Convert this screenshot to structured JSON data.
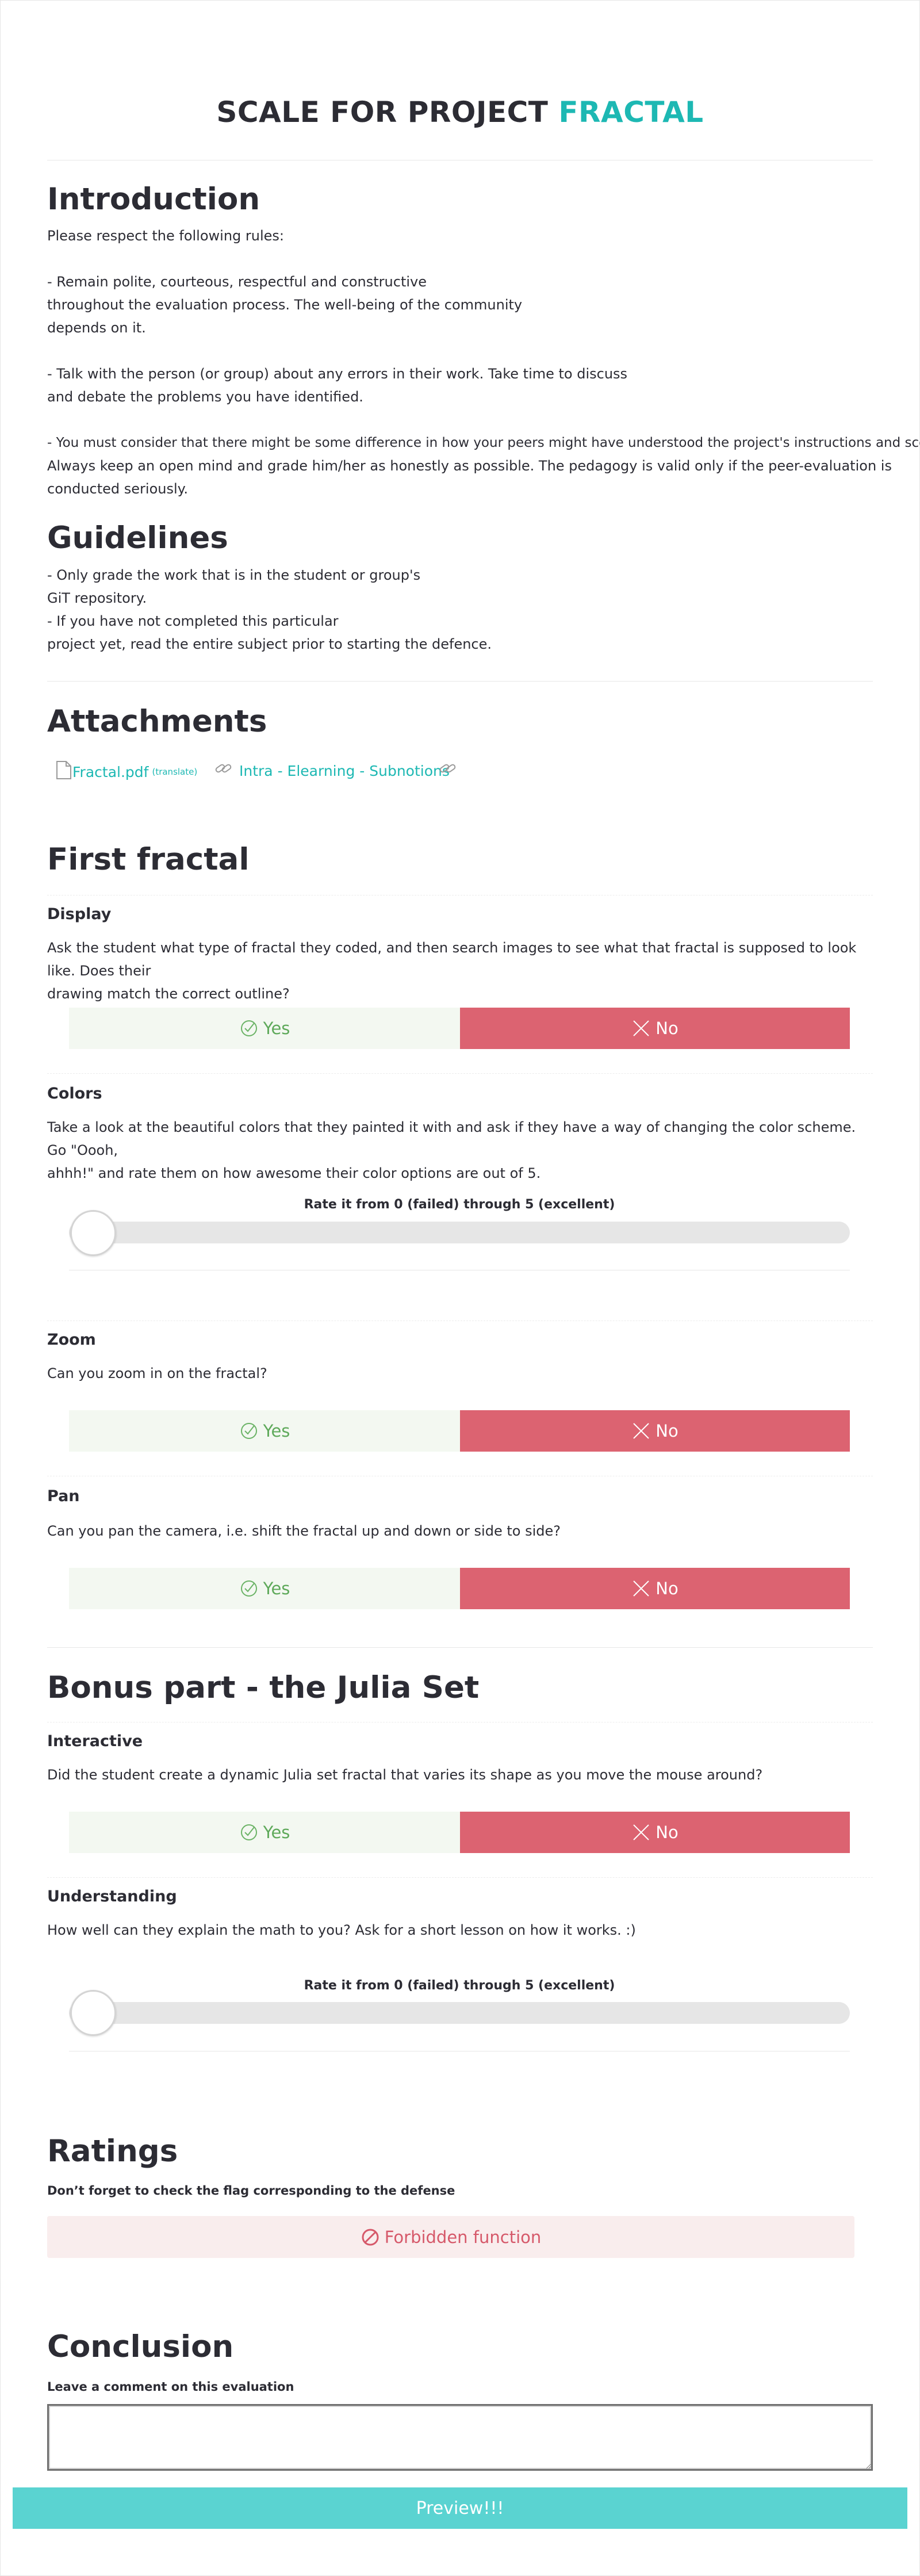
{
  "header": {
    "title_prefix": "SCALE FOR PROJECT",
    "title_accent": "FRACTAL"
  },
  "introduction": {
    "title": "Introduction",
    "lines": [
      "Please respect the following rules:",
      "",
      "- Remain polite, courteous, respectful and constructive",
      "throughout the evaluation process. The well-being of the community",
      "depends on it.",
      "",
      "- Talk with the person (or group) about any errors in their work. Take time to discuss",
      "and debate the problems you have identified.",
      "",
      "- You must consider that there might be some difference in how your peers might have understood the project's instructions and scope.",
      "Always keep an open mind and grade him/her as honestly as possible. The pedagogy is valid only if the peer-evaluation is",
      "conducted seriously."
    ]
  },
  "guidelines": {
    "title": "Guidelines",
    "lines": [
      "- Only grade the work that is in the student or group's",
      "GiT repository.",
      "- If you have not completed this particular",
      "project yet, read the entire subject prior to starting the defence."
    ]
  },
  "attachments": {
    "title": "Attachments",
    "items": [
      {
        "label": "Fractal.pdf",
        "sub": "(translate)",
        "icon": "file-icon"
      },
      {
        "label": "Intra - Elearning - Subnotions",
        "icon": "link-icon"
      },
      {
        "label": "",
        "icon": "link-icon"
      }
    ]
  },
  "sections": [
    {
      "title": "First fractal",
      "questions": [
        {
          "title": "Display",
          "desc": [
            "Ask the student what type of fractal they coded, and then search images to see what that fractal is supposed to look like. Does their",
            "drawing match the correct outline?"
          ],
          "type": "yesno",
          "yes": "Yes",
          "no": "No"
        },
        {
          "title": "Colors",
          "desc": [
            "Take a look at the beautiful colors that they painted it with and ask if they have a way of changing the color scheme. Go \"Oooh,",
            "ahhh!\" and rate them on how awesome their color options are out of 5."
          ],
          "type": "rate",
          "rate_label": "Rate it from 0 (failed) through 5 (excellent)",
          "value": 0
        },
        {
          "title": "Zoom",
          "desc": [
            "Can you zoom in on the fractal?"
          ],
          "type": "yesno",
          "yes": "Yes",
          "no": "No"
        },
        {
          "title": "Pan",
          "desc": [
            "Can you pan the camera, i.e. shift the fractal up and down or side to side?"
          ],
          "type": "yesno",
          "yes": "Yes",
          "no": "No"
        }
      ]
    },
    {
      "title": "Bonus part - the Julia Set",
      "questions": [
        {
          "title": "Interactive",
          "desc": [
            "Did the student create a dynamic Julia set fractal that varies its shape as you move the mouse around?"
          ],
          "type": "yesno",
          "yes": "Yes",
          "no": "No"
        },
        {
          "title": "Understanding",
          "desc": [
            "How well can they explain the math to you? Ask for a short lesson on how it works. :)"
          ],
          "type": "rate",
          "rate_label": "Rate it from 0 (failed) through 5 (excellent)",
          "value": 0
        }
      ]
    }
  ],
  "ratings": {
    "title": "Ratings",
    "note": "Don’t forget to check the flag corresponding to the defense",
    "flag": "Forbidden function"
  },
  "conclusion": {
    "title": "Conclusion",
    "comment_label": "Leave a comment on this evaluation",
    "comment_value": ""
  },
  "preview_button": "Preview!!!",
  "colors": {
    "accent": "#1db8b3",
    "no_red": "#dc6371",
    "yes_green": "#5ea95a",
    "preview": "#5ad3d1"
  }
}
